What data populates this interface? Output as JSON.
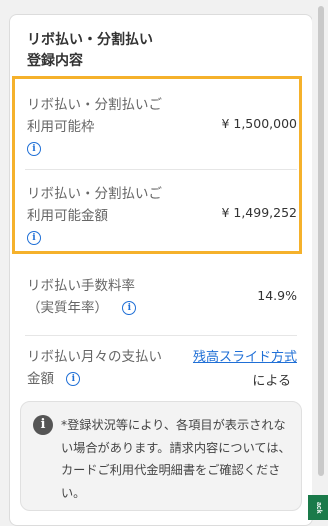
{
  "title": "リボ払い・分割払い登録内容",
  "rows": [
    {
      "label": "リボ払い・分割払いご利用可能枠",
      "value": "¥ 1,500,000"
    },
    {
      "label": "リボ払い・分割払いご利用可能金額",
      "value": "¥ 1,499,252"
    },
    {
      "label": "リボ払い手数料率（実質年率）",
      "value": "14.9%"
    },
    {
      "label": "リボ払い月々の支払い金額",
      "link": "残高スライド方式",
      "suffix": "による"
    }
  ],
  "info_icon_glyph": "i",
  "note": {
    "icon_glyph": "i",
    "text": "*登録状況等により、各項目が表示されない場合があります。請求内容については、カードご利用代金明細書をご確認ください。"
  },
  "feedback_tab_label": "ack",
  "colors": {
    "highlight": "#f5b12b",
    "link": "#1f6fd6",
    "feedback": "#1a7a4a"
  }
}
